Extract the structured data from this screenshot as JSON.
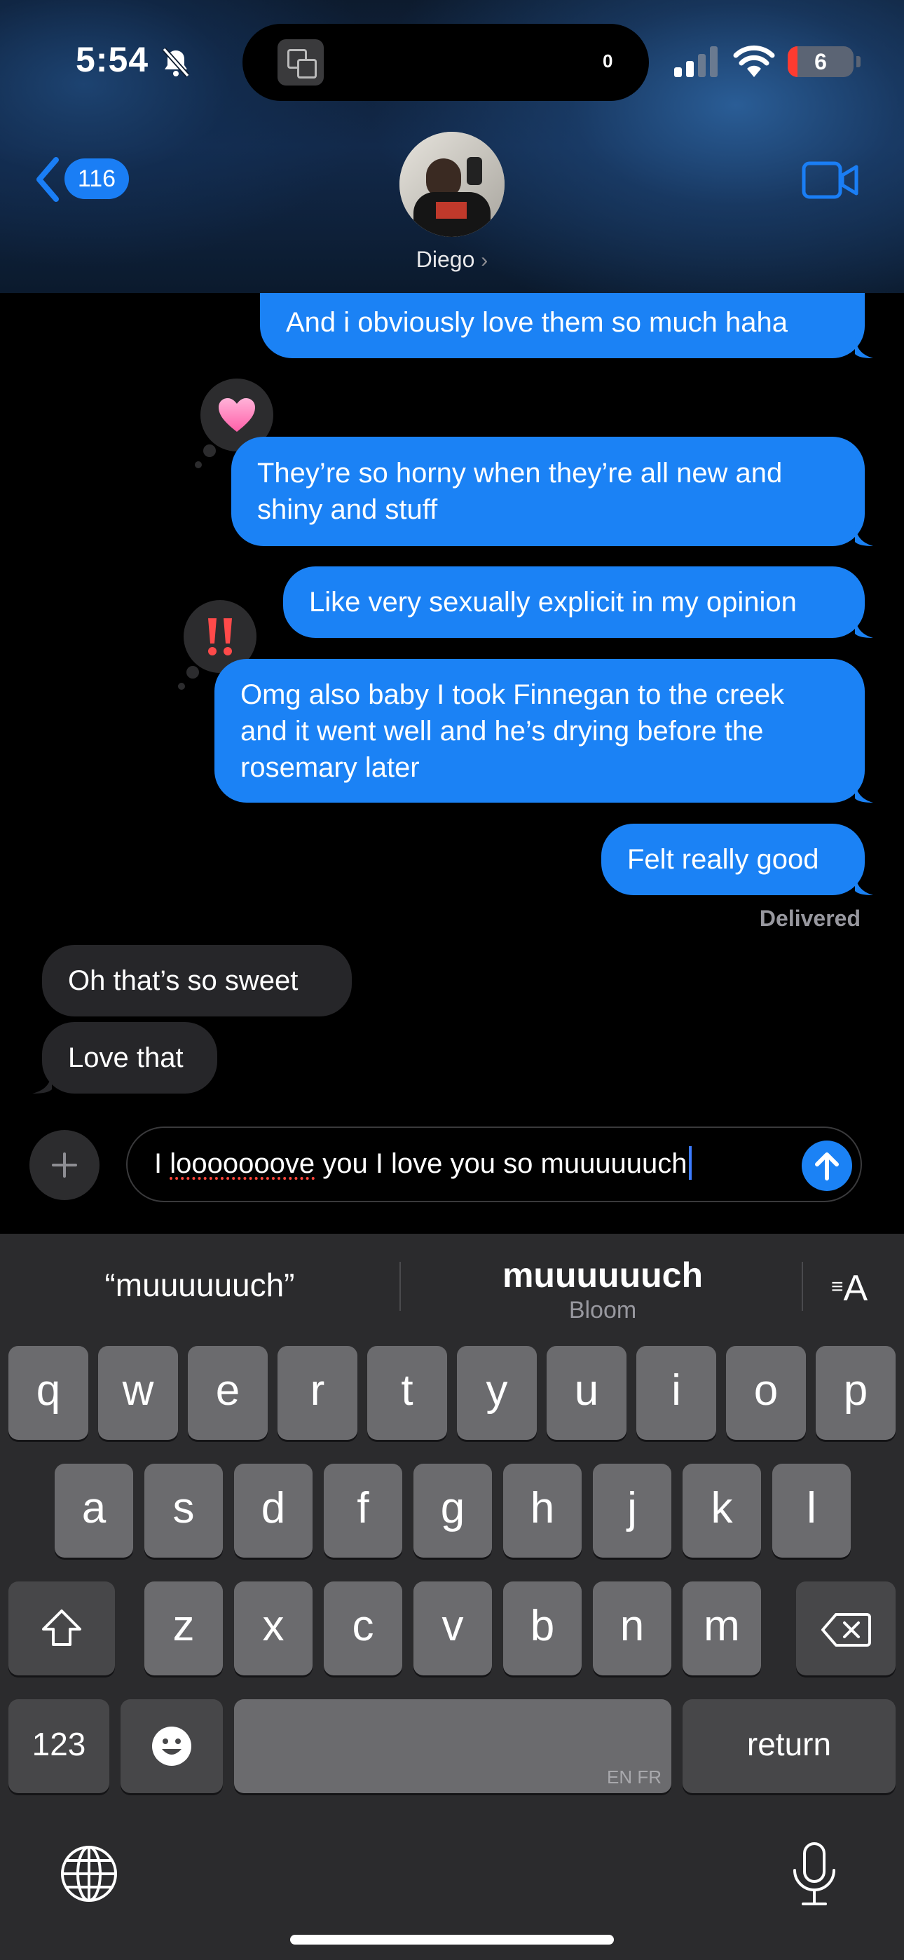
{
  "status_bar": {
    "time": "5:54",
    "island_count": "0",
    "battery": "6"
  },
  "header": {
    "back_count": "116",
    "contact_name": "Diego",
    "contact_chevron": "›"
  },
  "messages": [
    {
      "direction": "sent",
      "text": "And i obviously love them so much haha"
    },
    {
      "direction": "sent",
      "lines": [
        "They’re so horny when they’re all new and",
        "shiny and stuff"
      ],
      "tapback": "❤"
    },
    {
      "direction": "sent",
      "text": "Like very sexually explicit in my opinion"
    },
    {
      "direction": "sent",
      "lines": [
        "Omg also baby I took Finnegan to the creek",
        "and it went well and he’s drying before the",
        "rosemary later"
      ],
      "tapback": "‼"
    },
    {
      "direction": "sent",
      "text": "Felt really good"
    },
    {
      "direction": "received",
      "text": "Oh that’s so sweet"
    },
    {
      "direction": "received",
      "text": "Love that"
    }
  ],
  "delivered_label": "Delivered",
  "compose": {
    "text_prefix": "I ",
    "text_misspelled": "looooooove",
    "text_suffix": " you I love you so muuuuuuch"
  },
  "keyboard": {
    "suggestion_left": "“muuuuuuch”",
    "suggestion_center": "muuuuuuch",
    "suggestion_center_sub": "Bloom",
    "row1": [
      "q",
      "w",
      "e",
      "r",
      "t",
      "y",
      "u",
      "i",
      "o",
      "p"
    ],
    "row2": [
      "a",
      "s",
      "d",
      "f",
      "g",
      "h",
      "j",
      "k",
      "l"
    ],
    "row3": [
      "z",
      "x",
      "c",
      "v",
      "b",
      "n",
      "m"
    ],
    "numbers_label": "123",
    "space_lang": "EN FR",
    "return_label": "return"
  },
  "colors": {
    "sent_bubble": "#1b82f5",
    "received_bubble": "#262629",
    "accent": "#1a7ef5"
  }
}
